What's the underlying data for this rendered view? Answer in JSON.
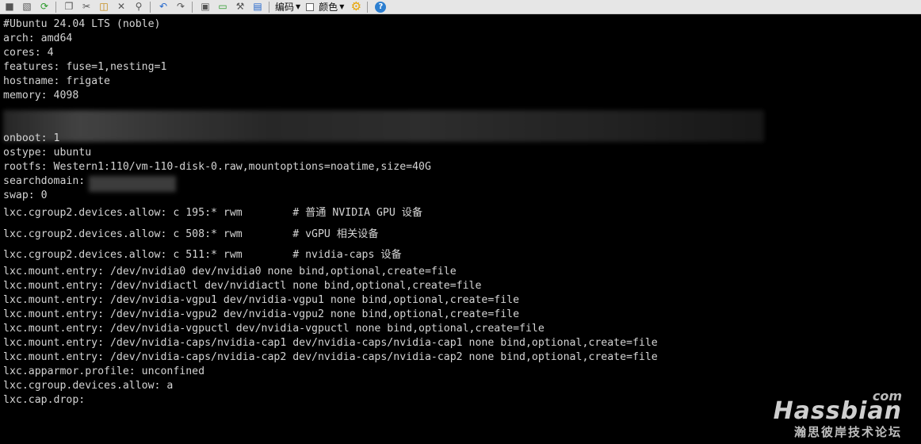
{
  "toolbar": {
    "encoding_label": "编码",
    "color_label": "颜色"
  },
  "terminal": {
    "lines": [
      "#Ubuntu 24.04 LTS (noble)",
      "arch: amd64",
      "cores: 4",
      "features: fuse=1,nesting=1",
      "hostname: frigate",
      "memory: 4098",
      "onboot: 1",
      "ostype: ubuntu",
      "rootfs: Western1:110/vm-110-disk-0.raw,mountoptions=noatime,size=40G",
      "searchdomain:",
      "swap: 0",
      "lxc.cgroup2.devices.allow: c 195:* rwm        # 普通 NVIDIA GPU 设备",
      "lxc.cgroup2.devices.allow: c 508:* rwm        # vGPU 相关设备",
      "lxc.cgroup2.devices.allow: c 511:* rwm        # nvidia-caps 设备",
      "lxc.mount.entry: /dev/nvidia0 dev/nvidia0 none bind,optional,create=file",
      "lxc.mount.entry: /dev/nvidiactl dev/nvidiactl none bind,optional,create=file",
      "lxc.mount.entry: /dev/nvidia-vgpu1 dev/nvidia-vgpu1 none bind,optional,create=file",
      "lxc.mount.entry: /dev/nvidia-vgpu2 dev/nvidia-vgpu2 none bind,optional,create=file",
      "lxc.mount.entry: /dev/nvidia-vgpuctl dev/nvidia-vgpuctl none bind,optional,create=file",
      "lxc.mount.entry: /dev/nvidia-caps/nvidia-cap1 dev/nvidia-caps/nvidia-cap1 none bind,optional,create=file",
      "lxc.mount.entry: /dev/nvidia-caps/nvidia-cap2 dev/nvidia-caps/nvidia-cap2 none bind,optional,create=file",
      "lxc.apparmor.profile: unconfined",
      "lxc.cgroup.devices.allow: a",
      "lxc.cap.drop:"
    ]
  },
  "watermark": {
    "com": "com",
    "brand": "Hassbian",
    "subtitle": "瀚思彼岸技术论坛"
  }
}
